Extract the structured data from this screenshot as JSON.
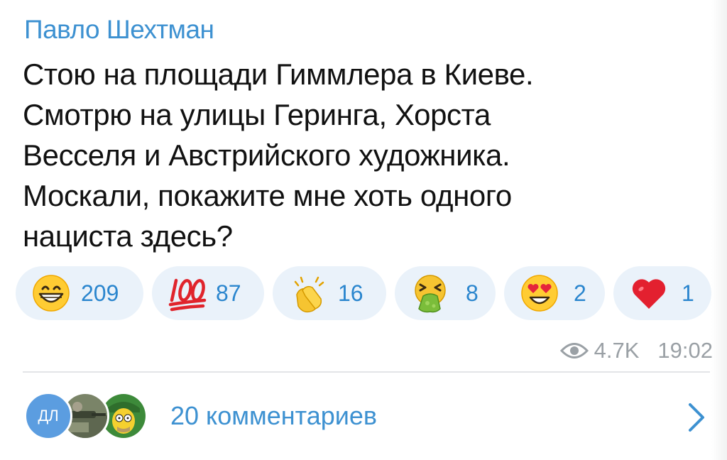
{
  "post": {
    "author": "Павло Шехтман",
    "text_lines": [
      "Стою на площади Гиммлера в Киеве.",
      "Смотрю на улицы Геринга, Хорста",
      "Весселя и Австрийского художника.",
      "Москали, покажите мне хоть одного",
      "нациста здесь?"
    ],
    "reactions": [
      {
        "icon": "grinning-face-icon",
        "count": "209"
      },
      {
        "icon": "hundred-points-icon",
        "count": "87"
      },
      {
        "icon": "clapping-hands-icon",
        "count": "16"
      },
      {
        "icon": "vomiting-face-icon",
        "count": "8"
      },
      {
        "icon": "heart-eyes-face-icon",
        "count": "2"
      },
      {
        "icon": "red-heart-icon",
        "count": "1"
      }
    ],
    "views": "4.7K",
    "time": "19:02"
  },
  "comments": {
    "avatar_initials": "ДЛ",
    "label": "20 комментариев",
    "open_icon": "chevron-right-icon"
  },
  "colors": {
    "accent": "#3d91d1",
    "reaction_bg": "#eaf2fa",
    "meta_text": "#9aa0a5",
    "avatar_blue": "#5b9de0"
  }
}
